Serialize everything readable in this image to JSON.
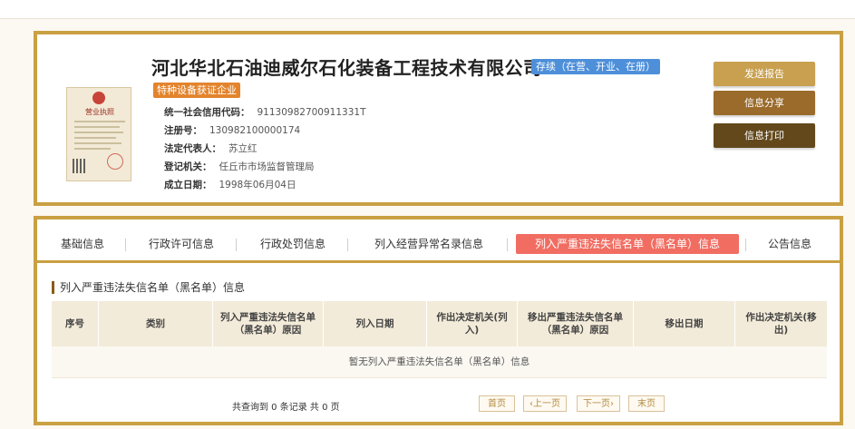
{
  "company": {
    "name": "河北华北石油迪威尔石化装备工程技术有限公司",
    "status": "存续（在营、开业、在册）",
    "cert_badge": "特种设备获证企业"
  },
  "license_image": {
    "title": "营业执照",
    "icon": "business-license-icon"
  },
  "info": [
    {
      "label": "统一社会信用代码：",
      "value": "91130982700911331T"
    },
    {
      "label": "注册号：",
      "value": "130982100000174"
    },
    {
      "label": "法定代表人：",
      "value": "苏立红"
    },
    {
      "label": "登记机关：",
      "value": "任丘市市场监督管理局"
    },
    {
      "label": "成立日期：",
      "value": "1998年06月04日"
    }
  ],
  "actions": {
    "report": "发送报告",
    "share": "信息分享",
    "print": "信息打印"
  },
  "tabs": [
    {
      "label": "基础信息"
    },
    {
      "label": "行政许可信息"
    },
    {
      "label": "行政处罚信息"
    },
    {
      "label": "列入经营异常名录信息"
    },
    {
      "label": "列入严重违法失信名单（黑名单）信息",
      "active": true
    },
    {
      "label": "公告信息"
    }
  ],
  "section": {
    "title": "列入严重违法失信名单（黑名单）信息",
    "columns": [
      "序号",
      "类别",
      "列入严重违法失信名单（黑名单）原因",
      "列入日期",
      "作出决定机关(列入)",
      "移出严重违法失信名单（黑名单）原因",
      "移出日期",
      "作出决定机关(移出)"
    ],
    "empty_text": "暂无列入严重违法失信名单（黑名单）信息"
  },
  "pagination": {
    "summary": "共查询到 0 条记录 共 0 页",
    "first": "首页",
    "prev": "‹上一页",
    "next": "下一页›",
    "last": "末页"
  },
  "colors": {
    "frame_gold": "#c9a042",
    "active_tab": "#f16d62",
    "status_blue": "#4d8fd9",
    "cert_orange": "#e3842d",
    "btn_report": "#c8a04f",
    "btn_share": "#9a6b2b",
    "btn_print": "#62481b"
  }
}
